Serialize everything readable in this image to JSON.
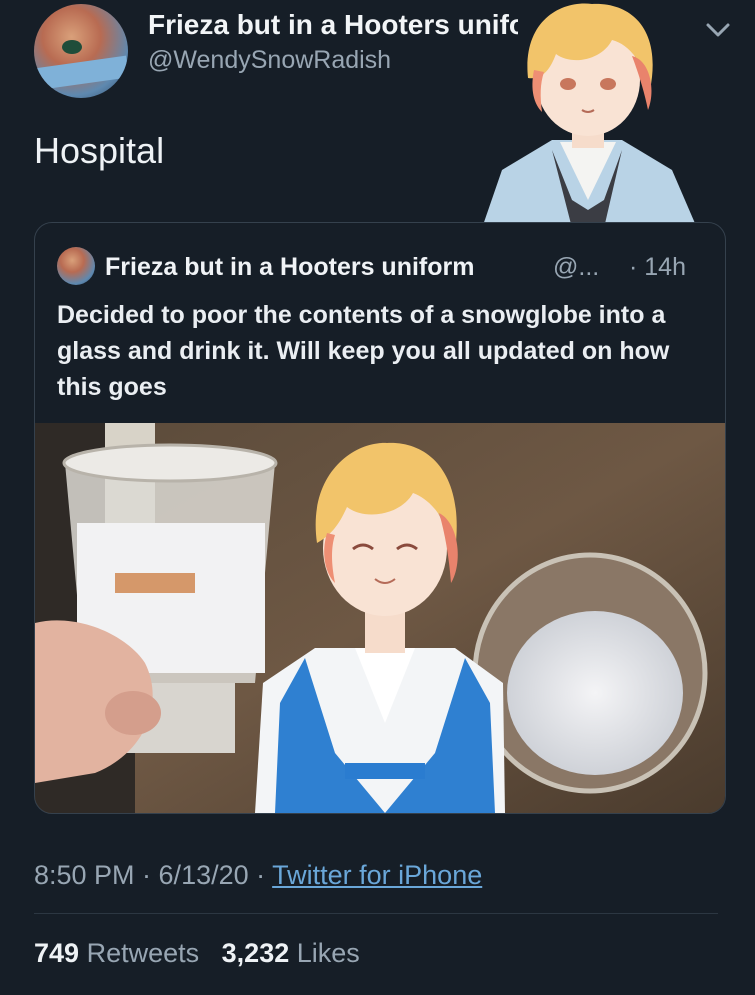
{
  "author": {
    "display_name": "Frieza but in a Hooters uniform",
    "handle": "@WendySnowRadish"
  },
  "tweet": {
    "text": "Hospital",
    "timestamp": "8:50 PM · 6/13/20 · ",
    "source": "Twitter for iPhone"
  },
  "quoted_tweet": {
    "display_name": "Frieza but in a Hooters uniform",
    "handle": "@...",
    "time": "· 14h",
    "text": "Decided to poor the contents of a snowglobe into a glass and drink it. Will keep you all updated on how this goes"
  },
  "stats": {
    "retweets_count": "749",
    "retweets_label": "Retweets",
    "likes_count": "3,232",
    "likes_label": "Likes"
  },
  "icons": {
    "menu": "chevron-down-icon"
  }
}
